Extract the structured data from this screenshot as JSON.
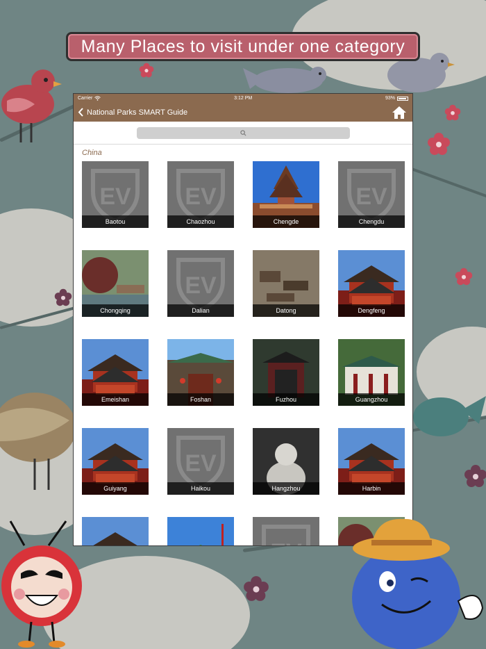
{
  "banner": {
    "text": "Many Places to visit under one category"
  },
  "status": {
    "carrier": "Carrier",
    "time": "3:12 PM",
    "battery": "93%"
  },
  "nav": {
    "back_label": "National Parks SMART Guide",
    "home_icon": "home-icon"
  },
  "search": {
    "icon": "search-icon"
  },
  "section": {
    "title": "China"
  },
  "places": [
    {
      "name": "Baotou",
      "style": "placeholder"
    },
    {
      "name": "Chaozhou",
      "style": "placeholder"
    },
    {
      "name": "Chengde",
      "style": "pagoda-sky"
    },
    {
      "name": "Chengdu",
      "style": "placeholder"
    },
    {
      "name": "Chongqing",
      "style": "trees-lake"
    },
    {
      "name": "Dalian",
      "style": "placeholder"
    },
    {
      "name": "Datong",
      "style": "cliff-temple"
    },
    {
      "name": "Dengfeng",
      "style": "red-temple"
    },
    {
      "name": "Emeishan",
      "style": "red-temple"
    },
    {
      "name": "Foshan",
      "style": "gate"
    },
    {
      "name": "Fuzhou",
      "style": "gate-dark"
    },
    {
      "name": "Guangzhou",
      "style": "white-hall"
    },
    {
      "name": "Guiyang",
      "style": "red-temple"
    },
    {
      "name": "Haikou",
      "style": "placeholder"
    },
    {
      "name": "Hangzhou",
      "style": "buddha"
    },
    {
      "name": "Harbin",
      "style": "red-temple"
    },
    {
      "name": "",
      "style": "red-temple"
    },
    {
      "name": "",
      "style": "green-roof"
    },
    {
      "name": "",
      "style": "placeholder"
    },
    {
      "name": "",
      "style": "trees-lake"
    }
  ],
  "colors": {
    "nav": "#8b6a4f",
    "banner": "#b9606c",
    "background": "#6f8584"
  }
}
